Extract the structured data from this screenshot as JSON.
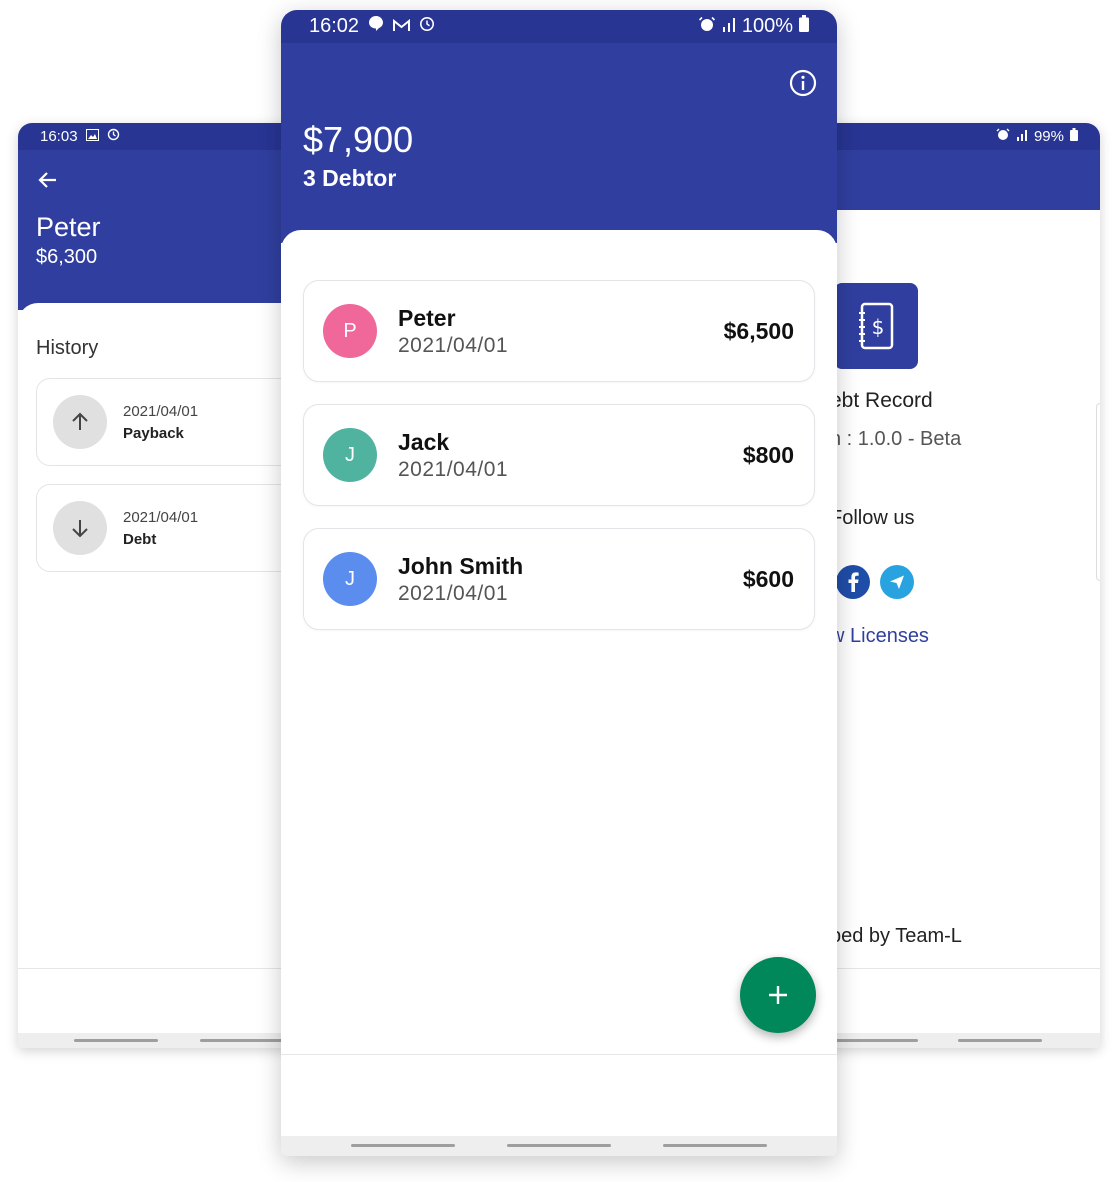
{
  "left_screen": {
    "status": {
      "time": "16:03"
    },
    "header": {
      "back_icon": "arrow-left-icon",
      "name": "Peter",
      "amount": "$6,300"
    },
    "section_title": "History",
    "history": [
      {
        "date": "2021/04/01",
        "type": "Payback",
        "icon": "arrow-up-icon"
      },
      {
        "date": "2021/04/01",
        "type": "Debt",
        "icon": "arrow-down-icon"
      }
    ]
  },
  "center_screen": {
    "status": {
      "time": "16:02",
      "battery": "100%"
    },
    "header": {
      "info_icon": "info-icon",
      "total": "$7,900",
      "count": "3 Debtor"
    },
    "debtors": [
      {
        "initial": "P",
        "name": "Peter",
        "date": "2021/04/01",
        "amount": "$6,500",
        "color": "#f0679a"
      },
      {
        "initial": "J",
        "name": "Jack",
        "date": "2021/04/01",
        "amount": "$800",
        "color": "#4fb3a0"
      },
      {
        "initial": "J",
        "name": "John Smith",
        "date": "2021/04/01",
        "amount": "$600",
        "color": "#5b8def"
      }
    ],
    "fab_icon": "plus-icon"
  },
  "right_screen": {
    "status": {
      "battery": "99%"
    },
    "app_icon": "dollar-notebook-icon",
    "app_name": "ebt Record",
    "version": "n : 1.0.0 - Beta",
    "follow_label": "Follow us",
    "social": [
      {
        "icon": "facebook-icon",
        "color": "#1f4ea8"
      },
      {
        "icon": "telegram-icon",
        "color": "#29a3e0"
      }
    ],
    "licenses_link": "w Licenses",
    "developer": "ped by Team-L"
  },
  "colors": {
    "primary": "#303f9f",
    "status_bar": "#283593",
    "fab": "#00875a"
  }
}
